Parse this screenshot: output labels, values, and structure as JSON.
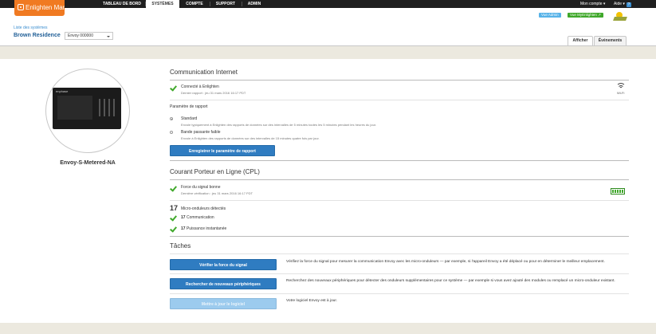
{
  "header": {
    "app_name": "Enlighten Manager",
    "nav": [
      "TABLEAU DE BORD",
      "SYSTÈMES",
      "COMPTE",
      "SUPPORT",
      "ADMIN"
    ],
    "account_label": "Mon compte",
    "help_label": "Aide",
    "help_badge": "?",
    "admin_view_tag": "Vue Admin",
    "myenlighten_tag": "Vue MyEnlighten",
    "colors": {
      "brand": "#f07a22",
      "topbar": "#1f1f1f",
      "accent": "#2f7cc1",
      "ok": "#3fa82a"
    }
  },
  "site": {
    "breadcrumb": "Liste des systèmes",
    "name": "Brown Residence",
    "envoy_select": "Envoy 000000"
  },
  "subtabs": [
    "Afficher",
    "Événements"
  ],
  "device": {
    "name": "Envoy-S-Metered-NA",
    "brand": "enphase"
  },
  "internet": {
    "title": "Communication Internet",
    "status": "Connecté à Enlighten",
    "last_report": "Dernier rapport : jeu 31 mars 2016 16:17 PDT",
    "wifi_label": "Wi-Fi",
    "report_title": "Paramètre de rapport",
    "standard_label": "Standard",
    "standard_desc": "Envoie typiquement à Enlighten des rapports de données sur des intervalles de 5 minutes toutes les 5 minutes pendant les heures du jour.",
    "low_label": "Bande passante faible",
    "low_desc": "Envoie à Enlighten des rapports de données sur des intervalles de 15 minutes quatre fois par jour.",
    "save_button": "Enregistrer le paramètre de rapport"
  },
  "plc": {
    "title": "Courant Porteur en Ligne (CPL)",
    "signal_status": "Force du signal bonne",
    "last_check": "Dernière vérification : jeu 31 mars 2016 16:17 PDT",
    "signal_level": 5,
    "detected_count": "17",
    "detected_label": "Micro-onduleurs détectés",
    "comm_count": "17",
    "comm_label": "Communication",
    "power_count": "17",
    "power_label": "Puissance instantanée"
  },
  "tasks": {
    "title": "Tâches",
    "items": [
      {
        "button": "Vérifier la force du signal",
        "desc": "Vérifiez la force du signal pour mesurer la communication Envoy avec les micro-onduleurs — par exemple, si l'appareil Envoy a été déplacé ou pour en déterminer le meilleur emplacement.",
        "enabled": true
      },
      {
        "button": "Rechercher de nouveaux périphériques",
        "desc": "Recherchez des nouveaux périphériques pour détecter des onduleurs supplémentaires pour ce système — par exemple si vous avez ajouté des modules ou remplacé un micro-onduleur existant.",
        "enabled": true
      },
      {
        "button": "Mettre à jour le logiciel",
        "desc": "Votre logiciel Envoy est à jour.",
        "enabled": false
      }
    ]
  }
}
